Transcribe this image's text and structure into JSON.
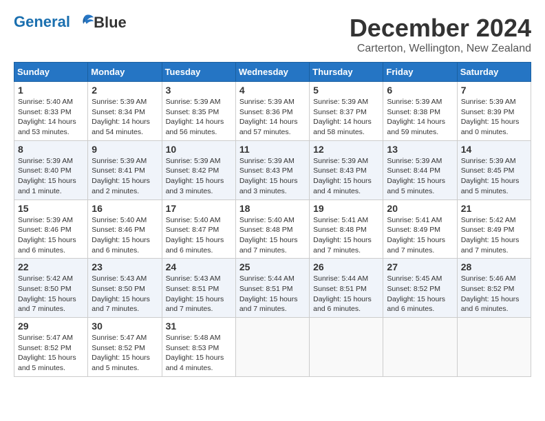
{
  "logo": {
    "line1": "General",
    "line2": "Blue"
  },
  "title": "December 2024",
  "subtitle": "Carterton, Wellington, New Zealand",
  "days_of_week": [
    "Sunday",
    "Monday",
    "Tuesday",
    "Wednesday",
    "Thursday",
    "Friday",
    "Saturday"
  ],
  "weeks": [
    [
      {
        "day": "1",
        "info": "Sunrise: 5:40 AM\nSunset: 8:33 PM\nDaylight: 14 hours\nand 53 minutes."
      },
      {
        "day": "2",
        "info": "Sunrise: 5:39 AM\nSunset: 8:34 PM\nDaylight: 14 hours\nand 54 minutes."
      },
      {
        "day": "3",
        "info": "Sunrise: 5:39 AM\nSunset: 8:35 PM\nDaylight: 14 hours\nand 56 minutes."
      },
      {
        "day": "4",
        "info": "Sunrise: 5:39 AM\nSunset: 8:36 PM\nDaylight: 14 hours\nand 57 minutes."
      },
      {
        "day": "5",
        "info": "Sunrise: 5:39 AM\nSunset: 8:37 PM\nDaylight: 14 hours\nand 58 minutes."
      },
      {
        "day": "6",
        "info": "Sunrise: 5:39 AM\nSunset: 8:38 PM\nDaylight: 14 hours\nand 59 minutes."
      },
      {
        "day": "7",
        "info": "Sunrise: 5:39 AM\nSunset: 8:39 PM\nDaylight: 15 hours\nand 0 minutes."
      }
    ],
    [
      {
        "day": "8",
        "info": "Sunrise: 5:39 AM\nSunset: 8:40 PM\nDaylight: 15 hours\nand 1 minute."
      },
      {
        "day": "9",
        "info": "Sunrise: 5:39 AM\nSunset: 8:41 PM\nDaylight: 15 hours\nand 2 minutes."
      },
      {
        "day": "10",
        "info": "Sunrise: 5:39 AM\nSunset: 8:42 PM\nDaylight: 15 hours\nand 3 minutes."
      },
      {
        "day": "11",
        "info": "Sunrise: 5:39 AM\nSunset: 8:43 PM\nDaylight: 15 hours\nand 3 minutes."
      },
      {
        "day": "12",
        "info": "Sunrise: 5:39 AM\nSunset: 8:43 PM\nDaylight: 15 hours\nand 4 minutes."
      },
      {
        "day": "13",
        "info": "Sunrise: 5:39 AM\nSunset: 8:44 PM\nDaylight: 15 hours\nand 5 minutes."
      },
      {
        "day": "14",
        "info": "Sunrise: 5:39 AM\nSunset: 8:45 PM\nDaylight: 15 hours\nand 5 minutes."
      }
    ],
    [
      {
        "day": "15",
        "info": "Sunrise: 5:39 AM\nSunset: 8:46 PM\nDaylight: 15 hours\nand 6 minutes."
      },
      {
        "day": "16",
        "info": "Sunrise: 5:40 AM\nSunset: 8:46 PM\nDaylight: 15 hours\nand 6 minutes."
      },
      {
        "day": "17",
        "info": "Sunrise: 5:40 AM\nSunset: 8:47 PM\nDaylight: 15 hours\nand 6 minutes."
      },
      {
        "day": "18",
        "info": "Sunrise: 5:40 AM\nSunset: 8:48 PM\nDaylight: 15 hours\nand 7 minutes."
      },
      {
        "day": "19",
        "info": "Sunrise: 5:41 AM\nSunset: 8:48 PM\nDaylight: 15 hours\nand 7 minutes."
      },
      {
        "day": "20",
        "info": "Sunrise: 5:41 AM\nSunset: 8:49 PM\nDaylight: 15 hours\nand 7 minutes."
      },
      {
        "day": "21",
        "info": "Sunrise: 5:42 AM\nSunset: 8:49 PM\nDaylight: 15 hours\nand 7 minutes."
      }
    ],
    [
      {
        "day": "22",
        "info": "Sunrise: 5:42 AM\nSunset: 8:50 PM\nDaylight: 15 hours\nand 7 minutes."
      },
      {
        "day": "23",
        "info": "Sunrise: 5:43 AM\nSunset: 8:50 PM\nDaylight: 15 hours\nand 7 minutes."
      },
      {
        "day": "24",
        "info": "Sunrise: 5:43 AM\nSunset: 8:51 PM\nDaylight: 15 hours\nand 7 minutes."
      },
      {
        "day": "25",
        "info": "Sunrise: 5:44 AM\nSunset: 8:51 PM\nDaylight: 15 hours\nand 7 minutes."
      },
      {
        "day": "26",
        "info": "Sunrise: 5:44 AM\nSunset: 8:51 PM\nDaylight: 15 hours\nand 6 minutes."
      },
      {
        "day": "27",
        "info": "Sunrise: 5:45 AM\nSunset: 8:52 PM\nDaylight: 15 hours\nand 6 minutes."
      },
      {
        "day": "28",
        "info": "Sunrise: 5:46 AM\nSunset: 8:52 PM\nDaylight: 15 hours\nand 6 minutes."
      }
    ],
    [
      {
        "day": "29",
        "info": "Sunrise: 5:47 AM\nSunset: 8:52 PM\nDaylight: 15 hours\nand 5 minutes."
      },
      {
        "day": "30",
        "info": "Sunrise: 5:47 AM\nSunset: 8:52 PM\nDaylight: 15 hours\nand 5 minutes."
      },
      {
        "day": "31",
        "info": "Sunrise: 5:48 AM\nSunset: 8:53 PM\nDaylight: 15 hours\nand 4 minutes."
      },
      {
        "day": "",
        "info": ""
      },
      {
        "day": "",
        "info": ""
      },
      {
        "day": "",
        "info": ""
      },
      {
        "day": "",
        "info": ""
      }
    ]
  ]
}
